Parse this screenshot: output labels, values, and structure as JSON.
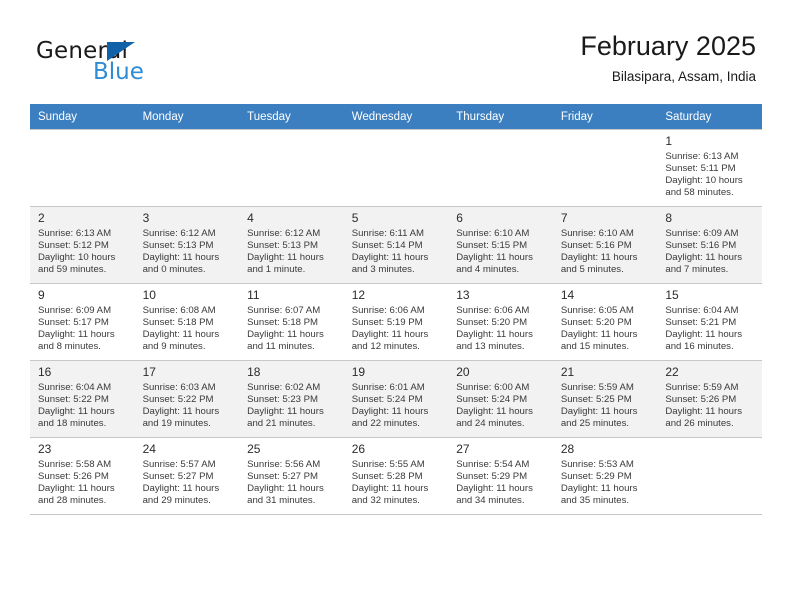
{
  "brand": {
    "word_general": "General",
    "word_blue": "Blue",
    "triangle_color": "#1061a8",
    "blue_color": "#2e8bd4"
  },
  "header": {
    "title": "February 2025",
    "subtitle": "Bilasipara, Assam, India"
  },
  "theme": {
    "header_row_bg": "#3c7fc1",
    "shaded_row_bg": "#f2f2f2",
    "grid_line": "#c8c8c8"
  },
  "weekdays": [
    "Sunday",
    "Monday",
    "Tuesday",
    "Wednesday",
    "Thursday",
    "Friday",
    "Saturday"
  ],
  "weeks": [
    [
      {
        "day": "",
        "details": ""
      },
      {
        "day": "",
        "details": ""
      },
      {
        "day": "",
        "details": ""
      },
      {
        "day": "",
        "details": ""
      },
      {
        "day": "",
        "details": ""
      },
      {
        "day": "",
        "details": ""
      },
      {
        "day": "1",
        "details": "Sunrise: 6:13 AM\nSunset: 5:11 PM\nDaylight: 10 hours\nand 58 minutes."
      }
    ],
    [
      {
        "day": "2",
        "details": "Sunrise: 6:13 AM\nSunset: 5:12 PM\nDaylight: 10 hours\nand 59 minutes."
      },
      {
        "day": "3",
        "details": "Sunrise: 6:12 AM\nSunset: 5:13 PM\nDaylight: 11 hours\nand 0 minutes."
      },
      {
        "day": "4",
        "details": "Sunrise: 6:12 AM\nSunset: 5:13 PM\nDaylight: 11 hours\nand 1 minute."
      },
      {
        "day": "5",
        "details": "Sunrise: 6:11 AM\nSunset: 5:14 PM\nDaylight: 11 hours\nand 3 minutes."
      },
      {
        "day": "6",
        "details": "Sunrise: 6:10 AM\nSunset: 5:15 PM\nDaylight: 11 hours\nand 4 minutes."
      },
      {
        "day": "7",
        "details": "Sunrise: 6:10 AM\nSunset: 5:16 PM\nDaylight: 11 hours\nand 5 minutes."
      },
      {
        "day": "8",
        "details": "Sunrise: 6:09 AM\nSunset: 5:16 PM\nDaylight: 11 hours\nand 7 minutes."
      }
    ],
    [
      {
        "day": "9",
        "details": "Sunrise: 6:09 AM\nSunset: 5:17 PM\nDaylight: 11 hours\nand 8 minutes."
      },
      {
        "day": "10",
        "details": "Sunrise: 6:08 AM\nSunset: 5:18 PM\nDaylight: 11 hours\nand 9 minutes."
      },
      {
        "day": "11",
        "details": "Sunrise: 6:07 AM\nSunset: 5:18 PM\nDaylight: 11 hours\nand 11 minutes."
      },
      {
        "day": "12",
        "details": "Sunrise: 6:06 AM\nSunset: 5:19 PM\nDaylight: 11 hours\nand 12 minutes."
      },
      {
        "day": "13",
        "details": "Sunrise: 6:06 AM\nSunset: 5:20 PM\nDaylight: 11 hours\nand 13 minutes."
      },
      {
        "day": "14",
        "details": "Sunrise: 6:05 AM\nSunset: 5:20 PM\nDaylight: 11 hours\nand 15 minutes."
      },
      {
        "day": "15",
        "details": "Sunrise: 6:04 AM\nSunset: 5:21 PM\nDaylight: 11 hours\nand 16 minutes."
      }
    ],
    [
      {
        "day": "16",
        "details": "Sunrise: 6:04 AM\nSunset: 5:22 PM\nDaylight: 11 hours\nand 18 minutes."
      },
      {
        "day": "17",
        "details": "Sunrise: 6:03 AM\nSunset: 5:22 PM\nDaylight: 11 hours\nand 19 minutes."
      },
      {
        "day": "18",
        "details": "Sunrise: 6:02 AM\nSunset: 5:23 PM\nDaylight: 11 hours\nand 21 minutes."
      },
      {
        "day": "19",
        "details": "Sunrise: 6:01 AM\nSunset: 5:24 PM\nDaylight: 11 hours\nand 22 minutes."
      },
      {
        "day": "20",
        "details": "Sunrise: 6:00 AM\nSunset: 5:24 PM\nDaylight: 11 hours\nand 24 minutes."
      },
      {
        "day": "21",
        "details": "Sunrise: 5:59 AM\nSunset: 5:25 PM\nDaylight: 11 hours\nand 25 minutes."
      },
      {
        "day": "22",
        "details": "Sunrise: 5:59 AM\nSunset: 5:26 PM\nDaylight: 11 hours\nand 26 minutes."
      }
    ],
    [
      {
        "day": "23",
        "details": "Sunrise: 5:58 AM\nSunset: 5:26 PM\nDaylight: 11 hours\nand 28 minutes."
      },
      {
        "day": "24",
        "details": "Sunrise: 5:57 AM\nSunset: 5:27 PM\nDaylight: 11 hours\nand 29 minutes."
      },
      {
        "day": "25",
        "details": "Sunrise: 5:56 AM\nSunset: 5:27 PM\nDaylight: 11 hours\nand 31 minutes."
      },
      {
        "day": "26",
        "details": "Sunrise: 5:55 AM\nSunset: 5:28 PM\nDaylight: 11 hours\nand 32 minutes."
      },
      {
        "day": "27",
        "details": "Sunrise: 5:54 AM\nSunset: 5:29 PM\nDaylight: 11 hours\nand 34 minutes."
      },
      {
        "day": "28",
        "details": "Sunrise: 5:53 AM\nSunset: 5:29 PM\nDaylight: 11 hours\nand 35 minutes."
      },
      {
        "day": "",
        "details": ""
      }
    ]
  ]
}
